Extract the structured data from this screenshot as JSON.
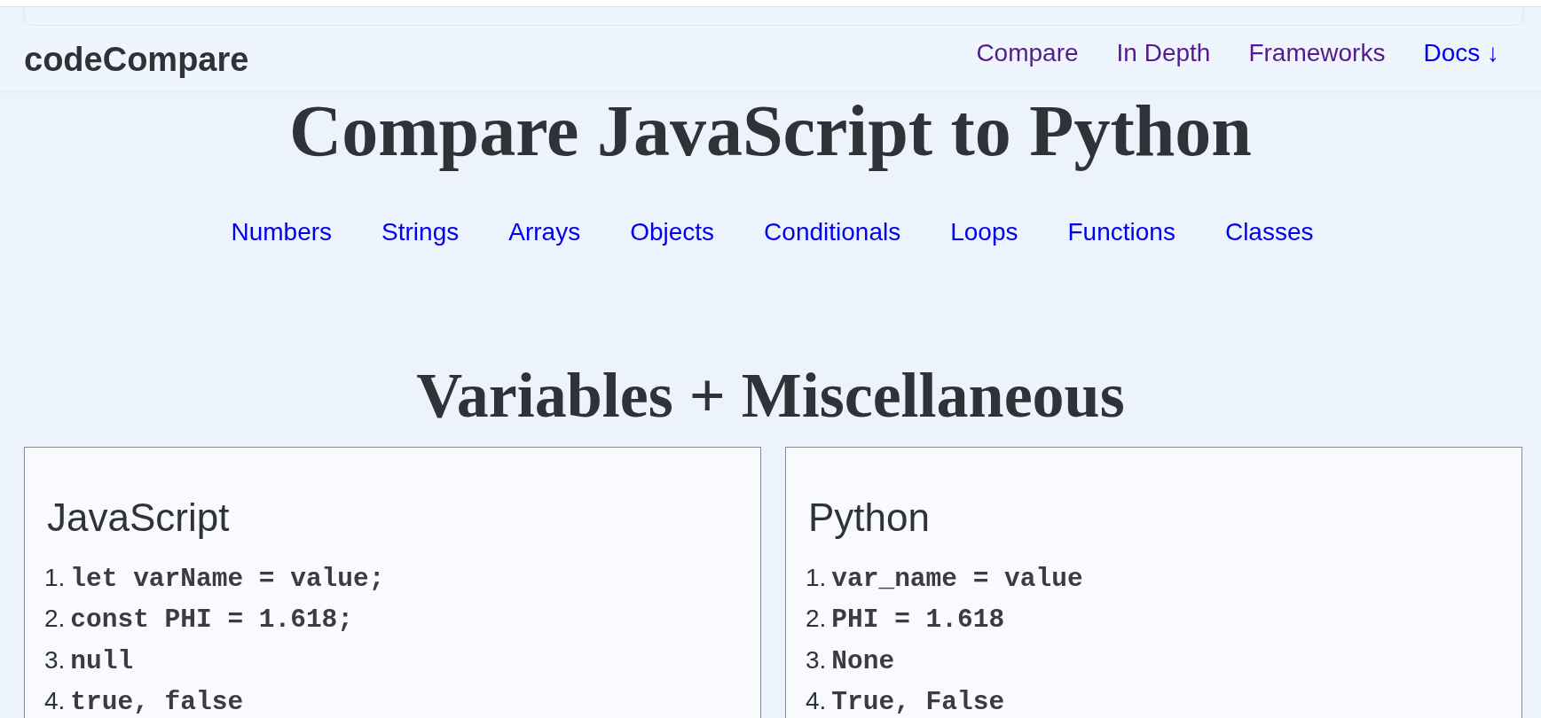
{
  "header": {
    "logo": "codeCompare",
    "nav": [
      {
        "label": "Compare",
        "visited": true
      },
      {
        "label": "In Depth",
        "visited": true
      },
      {
        "label": "Frameworks",
        "visited": true
      },
      {
        "label": "Docs ↓",
        "visited": false
      }
    ]
  },
  "title": "Compare JavaScript to Python",
  "topics": [
    {
      "label": "Numbers",
      "visited": false
    },
    {
      "label": "Strings",
      "visited": false
    },
    {
      "label": "Arrays",
      "visited": false
    },
    {
      "label": "Objects",
      "visited": false
    },
    {
      "label": "Conditionals",
      "visited": false
    },
    {
      "label": "Loops",
      "visited": false
    },
    {
      "label": "Functions",
      "visited": false
    },
    {
      "label": "Classes",
      "visited": false
    }
  ],
  "section": {
    "heading": "Variables + Miscellaneous",
    "panels": [
      {
        "language": "JavaScript",
        "lines": [
          {
            "number": "1.",
            "code": "let varName = value;"
          },
          {
            "number": "2.",
            "code": "const PHI = 1.618;"
          },
          {
            "number": "3.",
            "code": "null"
          },
          {
            "number": "4.",
            "code": "true, false"
          }
        ]
      },
      {
        "language": "Python",
        "lines": [
          {
            "number": "1.",
            "code": "var_name = value"
          },
          {
            "number": "2.",
            "code": "PHI = 1.618"
          },
          {
            "number": "3.",
            "code": "None"
          },
          {
            "number": "4.",
            "code": "True, False"
          }
        ]
      }
    ]
  }
}
